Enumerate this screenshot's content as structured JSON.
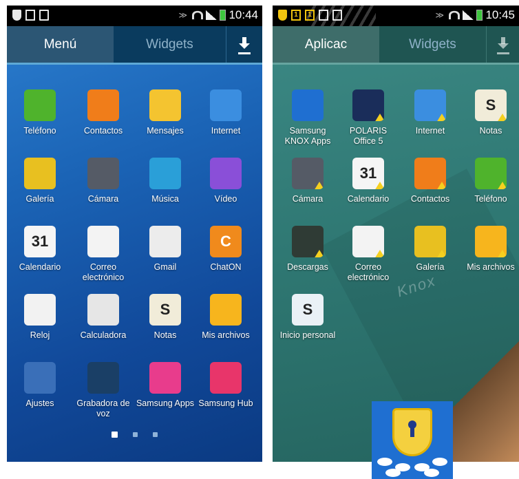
{
  "left": {
    "status_time": "10:44",
    "tabs": {
      "menu": "Menú",
      "widgets": "Widgets"
    },
    "apps": [
      {
        "label": "Teléfono",
        "icon": "phone-icon",
        "color": "#4fb32c"
      },
      {
        "label": "Contactos",
        "icon": "contacts-icon",
        "color": "#f07d1a"
      },
      {
        "label": "Mensajes",
        "icon": "messages-icon",
        "color": "#f4c430"
      },
      {
        "label": "Internet",
        "icon": "globe-icon",
        "color": "#3b8ee0"
      },
      {
        "label": "Galería",
        "icon": "gallery-icon",
        "color": "#e8c020"
      },
      {
        "label": "Cámara",
        "icon": "camera-icon",
        "color": "#555b66"
      },
      {
        "label": "Música",
        "icon": "music-icon",
        "color": "#2a9fd8"
      },
      {
        "label": "Vídeo",
        "icon": "video-icon",
        "color": "#8a4fd8"
      },
      {
        "label": "Calendario",
        "icon": "calendar-icon",
        "color": "#f5f5f5",
        "text": "31"
      },
      {
        "label": "Correo electrónico",
        "icon": "email-icon",
        "color": "#f3f3f3"
      },
      {
        "label": "Gmail",
        "icon": "gmail-icon",
        "color": "#ececec"
      },
      {
        "label": "ChatON",
        "icon": "chaton-icon",
        "color": "#f08a1c",
        "text": "C"
      },
      {
        "label": "Reloj",
        "icon": "clock-icon",
        "color": "#f2f2f2"
      },
      {
        "label": "Calculadora",
        "icon": "calculator-icon",
        "color": "#e6e6e6"
      },
      {
        "label": "Notas",
        "icon": "notes-icon",
        "color": "#f1ecd9",
        "text": "S"
      },
      {
        "label": "Mis archivos",
        "icon": "folder-icon",
        "color": "#f7b51d"
      },
      {
        "label": "Ajustes",
        "icon": "settings-icon",
        "color": "#3a6fb8"
      },
      {
        "label": "Grabadora de voz",
        "icon": "voice-recorder-icon",
        "color": "#1a3f66"
      },
      {
        "label": "Samsung Apps",
        "icon": "samsung-apps-icon",
        "color": "#e83c8c"
      },
      {
        "label": "Samsung Hub",
        "icon": "samsung-hub-icon",
        "color": "#e8356a"
      }
    ],
    "page_count": 3,
    "current_page": 1
  },
  "right": {
    "status_time": "10:45",
    "tabs": {
      "apps": "Aplicac",
      "widgets": "Widgets"
    },
    "apps": [
      {
        "label": "Samsung KNOX Apps",
        "icon": "knox-shield-icon",
        "color": "#1f6fd1",
        "warn": false
      },
      {
        "label": "POLARIS Office 5",
        "icon": "polaris-office-icon",
        "color": "#1a2d5a",
        "warn": true
      },
      {
        "label": "Internet",
        "icon": "globe-icon",
        "color": "#3b8ee0",
        "warn": true
      },
      {
        "label": "Notas",
        "icon": "notes-icon",
        "color": "#f1ecd9",
        "text": "S",
        "warn": true
      },
      {
        "label": "Cámara",
        "icon": "camera-icon",
        "color": "#555b66",
        "warn": true
      },
      {
        "label": "Calendario",
        "icon": "calendar-icon",
        "color": "#f5f5f5",
        "text": "31",
        "warn": true
      },
      {
        "label": "Contactos",
        "icon": "contacts-icon",
        "color": "#f07d1a",
        "warn": true
      },
      {
        "label": "Teléfono",
        "icon": "phone-icon",
        "color": "#4fb32c",
        "warn": true
      },
      {
        "label": "Descargas",
        "icon": "downloads-icon",
        "color": "#2f3b35",
        "warn": true
      },
      {
        "label": "Correo electrónico",
        "icon": "email-icon",
        "color": "#f3f3f3",
        "warn": true
      },
      {
        "label": "Galería",
        "icon": "gallery-icon",
        "color": "#e8c020",
        "warn": true
      },
      {
        "label": "Mis archivos",
        "icon": "folder-icon",
        "color": "#f7b51d",
        "warn": true
      },
      {
        "label": "Inicio personal",
        "icon": "personal-home-icon",
        "color": "#eaf1f6",
        "text": "S",
        "warn": false
      }
    ],
    "watermark": "Knox"
  }
}
